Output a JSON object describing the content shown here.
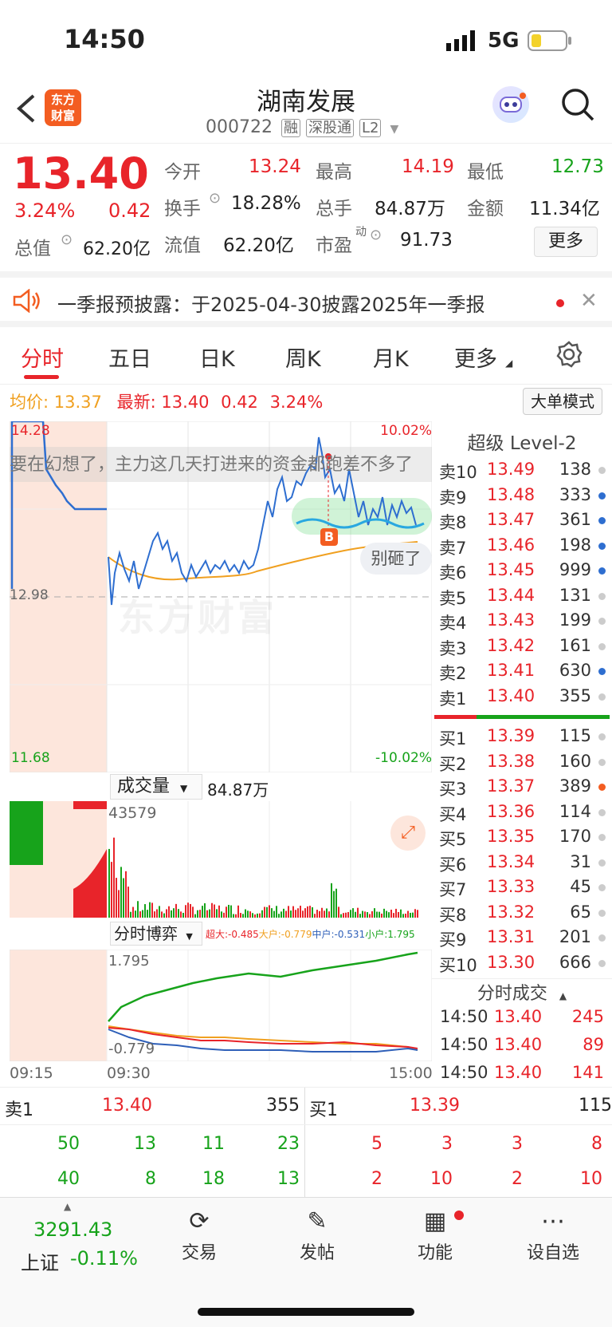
{
  "status": {
    "time": "14:50",
    "network": "5G"
  },
  "header": {
    "title": "湖南发展",
    "code": "000722",
    "tags": [
      "融",
      "深股通",
      "L2"
    ],
    "logo_text": "东方财富"
  },
  "quote": {
    "price": "13.40",
    "change_pct": "3.24%",
    "change": "0.42",
    "open_label": "今开",
    "open": "13.24",
    "high_label": "最高",
    "high": "14.19",
    "low_label": "最低",
    "low": "12.73",
    "turnover_label": "换手",
    "turnover": "18.28%",
    "volume_label": "总手",
    "volume": "84.87万",
    "amount_label": "金额",
    "amount": "11.34亿",
    "mktcap_label": "总值",
    "mktcap": "62.20亿",
    "float_label": "流值",
    "float": "62.20亿",
    "pe_label": "市盈",
    "pe_sup": "动",
    "pe": "91.73",
    "more": "更多"
  },
  "notice": {
    "text": "一季报预披露：于2025-04-30披露2025年一季报"
  },
  "tabs": [
    "分时",
    "五日",
    "日K",
    "周K",
    "月K",
    "更多"
  ],
  "summary": {
    "avg_label": "均价:",
    "avg": "13.37",
    "latest_label": "最新:",
    "latest": "13.40",
    "chg": "0.42",
    "pct": "3.24%",
    "mode_button": "大单模式"
  },
  "chart": {
    "y_top": "14.28",
    "y_mid": "12.98",
    "y_bottom": "11.68",
    "pct_top": "10.02%",
    "pct_bottom": "-10.02%",
    "danmaku": "要在幻想了，主力这几天打进来的资金都跑差不多了",
    "bubble": "别砸了",
    "watermark": "东方财富",
    "b_marker": "B",
    "volume_label": "成交量",
    "volume_total": "84.87万",
    "volume_max": "43579",
    "game_label": "分时博弈",
    "game_legend": [
      {
        "label": "超大:-0.485",
        "color": "#e8242a"
      },
      {
        "label": "大户:-0.779",
        "color": "#f0a020"
      },
      {
        "label": "中户:-0.531",
        "color": "#2e5fb8"
      },
      {
        "label": "小户:1.795",
        "color": "#17a31b"
      }
    ],
    "game_top": "1.795",
    "game_bottom": "-0.779",
    "time_start": "09:15",
    "time_open": "09:30",
    "time_end": "15:00"
  },
  "orderbook": {
    "title": "超级 Level-2",
    "sells": [
      {
        "label": "卖10",
        "price": "13.49",
        "vol": "138"
      },
      {
        "label": "卖9",
        "price": "13.48",
        "vol": "333"
      },
      {
        "label": "卖8",
        "price": "13.47",
        "vol": "361"
      },
      {
        "label": "卖7",
        "price": "13.46",
        "vol": "198"
      },
      {
        "label": "卖6",
        "price": "13.45",
        "vol": "999"
      },
      {
        "label": "卖5",
        "price": "13.44",
        "vol": "131"
      },
      {
        "label": "卖4",
        "price": "13.43",
        "vol": "199"
      },
      {
        "label": "卖3",
        "price": "13.42",
        "vol": "161"
      },
      {
        "label": "卖2",
        "price": "13.41",
        "vol": "630"
      },
      {
        "label": "卖1",
        "price": "13.40",
        "vol": "355"
      }
    ],
    "buys": [
      {
        "label": "买1",
        "price": "13.39",
        "vol": "115"
      },
      {
        "label": "买2",
        "price": "13.38",
        "vol": "160"
      },
      {
        "label": "买3",
        "price": "13.37",
        "vol": "389"
      },
      {
        "label": "买4",
        "price": "13.36",
        "vol": "114"
      },
      {
        "label": "买5",
        "price": "13.35",
        "vol": "170"
      },
      {
        "label": "买6",
        "price": "13.34",
        "vol": "31"
      },
      {
        "label": "买7",
        "price": "13.33",
        "vol": "45"
      },
      {
        "label": "买8",
        "price": "13.32",
        "vol": "65"
      },
      {
        "label": "买9",
        "price": "13.31",
        "vol": "201"
      },
      {
        "label": "买10",
        "price": "13.30",
        "vol": "666"
      }
    ],
    "trades_title": "分时成交",
    "trades": [
      {
        "time": "14:50",
        "price": "13.40",
        "vol": "245"
      },
      {
        "time": "14:50",
        "price": "13.40",
        "vol": "89"
      },
      {
        "time": "14:50",
        "price": "13.40",
        "vol": "141"
      }
    ]
  },
  "queue": {
    "sell_label": "卖1",
    "sell_price": "13.40",
    "sell_vol": "355",
    "buy_label": "买1",
    "buy_price": "13.39",
    "buy_vol": "115",
    "sell_row1": [
      "50",
      "13",
      "11",
      "23"
    ],
    "sell_row2": [
      "40",
      "8",
      "18",
      "13"
    ],
    "buy_row1": [
      "5",
      "3",
      "3",
      "8"
    ],
    "buy_row2": [
      "2",
      "10",
      "2",
      "10"
    ]
  },
  "nav": {
    "index_value": "3291.43",
    "index_name": "上证",
    "index_change": "-0.11%",
    "items": [
      "交易",
      "发帖",
      "功能",
      "设自选"
    ]
  }
}
